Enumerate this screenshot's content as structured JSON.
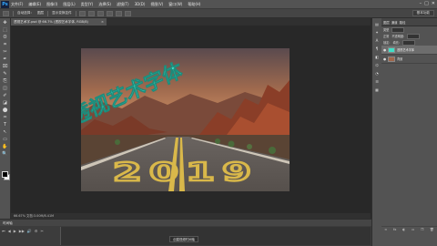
{
  "app": {
    "logo": "Ps",
    "menus": [
      "文件(F)",
      "编辑(E)",
      "图像(I)",
      "图层(L)",
      "类型(Y)",
      "选择(S)",
      "滤镜(T)",
      "3D(D)",
      "视图(V)",
      "窗口(W)",
      "帮助(H)"
    ],
    "window_controls": [
      "–",
      "□",
      "✕"
    ]
  },
  "options": {
    "auto_select_label": "自动选择：",
    "auto_select_value": "图层",
    "transform_label": "显示变换控件",
    "workspace": "基本功能"
  },
  "document": {
    "tab_title": "透视艺术字.psd @ 66.7% (透视艺术字体, RGB/8)",
    "close": "×",
    "status": "66.67%    文档:3.00M/8.41M"
  },
  "canvas": {
    "year_text": "2019",
    "art_text": "透视艺术字体",
    "art_text_color": "#3fe0c8"
  },
  "timeline": {
    "title": "时间轴",
    "create_button": "创建视频时间轴",
    "controls": [
      "⏮",
      "◀",
      "▶",
      "▶▶",
      "🔊",
      "⚙",
      "✂"
    ]
  },
  "panels": {
    "tabs": [
      "图层",
      "通道",
      "路径"
    ],
    "kind_label": "类型",
    "blend_mode": "正常",
    "opacity_label": "不透明度:",
    "lock_label": "锁定:",
    "fill_label": "填充:",
    "layers": [
      {
        "name": "透视艺术字体",
        "selected": true
      },
      {
        "name": "背景",
        "selected": false
      }
    ],
    "footer_icons": [
      "∞",
      "fx",
      "◐",
      "▭",
      "❐",
      "🗑"
    ]
  },
  "tools": [
    "✥",
    "⬚",
    "ʘ",
    "⌗",
    "✂",
    "✒",
    "⌧",
    "✎",
    "⎘",
    "◫",
    "✐",
    "◪",
    "⬤",
    "♒",
    "T",
    "↖",
    "▭",
    "✋",
    "🔍"
  ],
  "dock_icons": [
    "▤",
    "✦",
    "A",
    "¶",
    "◧",
    "⌬",
    "◔",
    "☰",
    "▦"
  ]
}
